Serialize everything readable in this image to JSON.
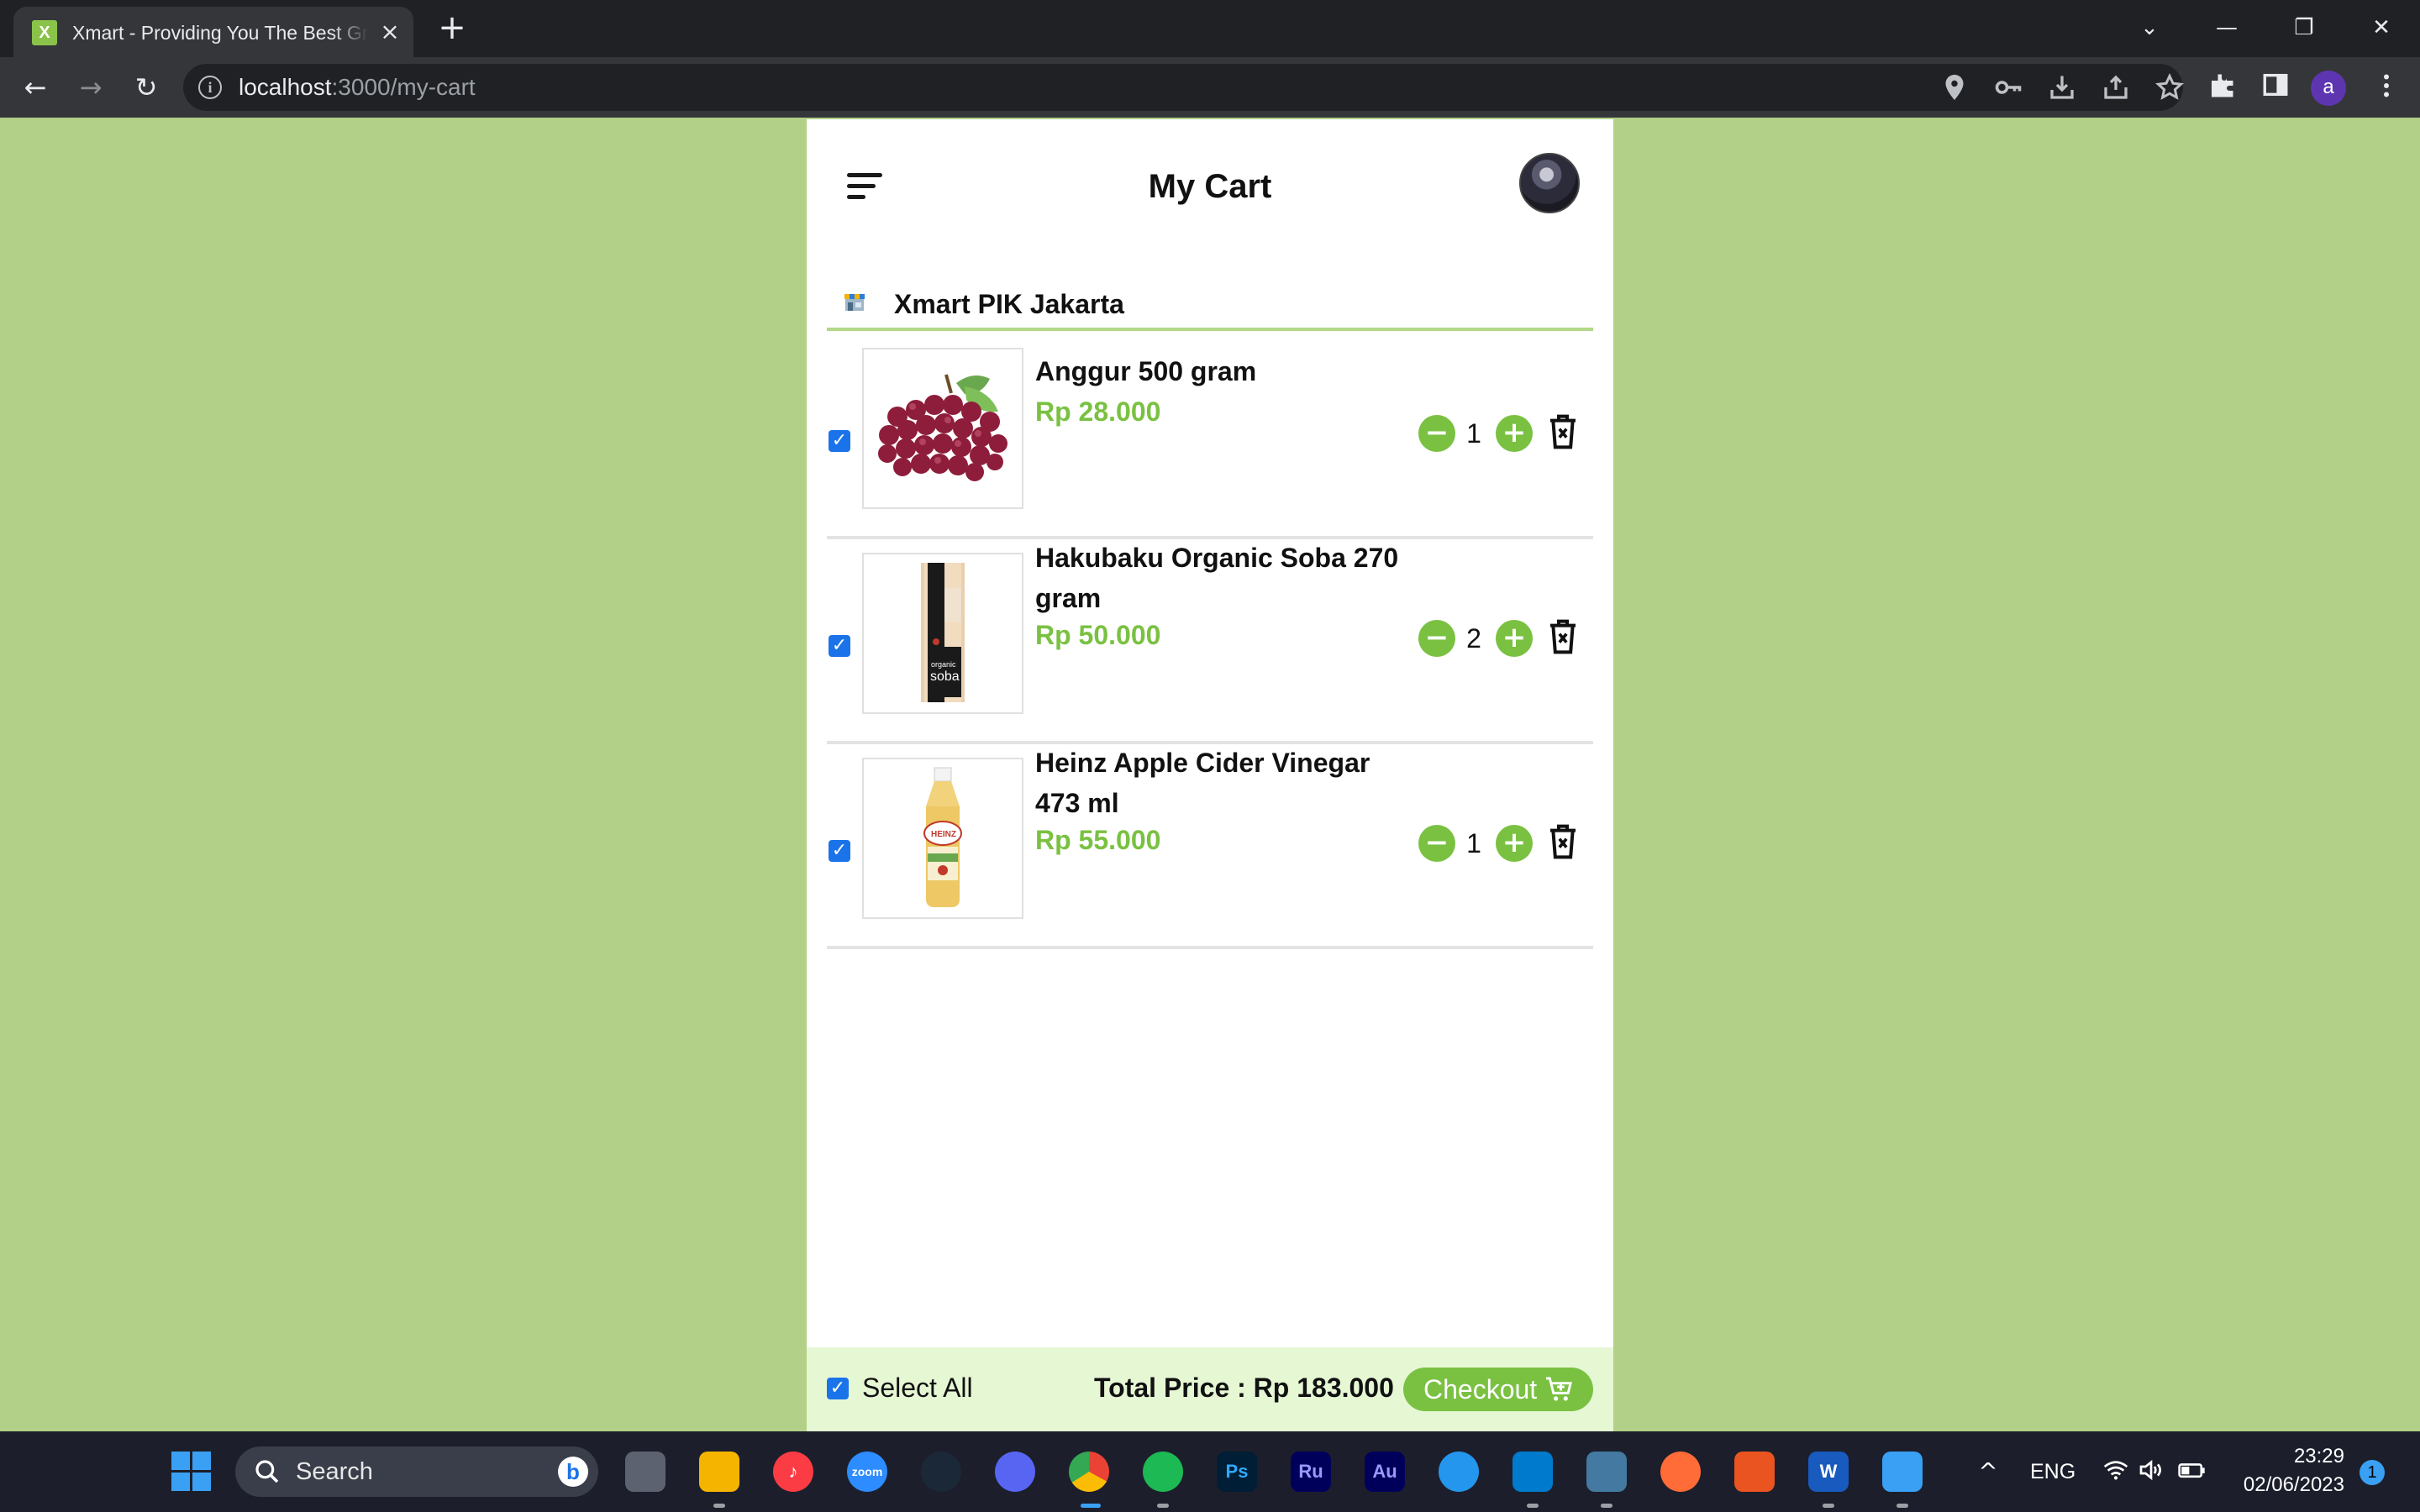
{
  "browser": {
    "tab_title": "Xmart - Providing You The Best Groceries",
    "tab_favicon_letter": "X",
    "tab_close": "×",
    "new_tab": "+",
    "url_host": "localhost",
    "url_path": ":3000/my-cart",
    "window_controls": {
      "dropdown": "⌄",
      "minimize": "—",
      "restore": "❐",
      "close": "✕"
    },
    "nav": {
      "back": "←",
      "forward": "→",
      "reload": "↻"
    },
    "info_icon": "i",
    "omnibox_icons": [
      "location-icon",
      "key-icon",
      "install-icon",
      "share-icon",
      "star-icon"
    ],
    "toolbar_icons": [
      "extensions-icon",
      "side-panel-icon",
      "more-icon"
    ],
    "profile_letter": "a"
  },
  "app": {
    "title": "My Cart",
    "store": {
      "name": "Xmart PIK Jakarta"
    },
    "accent_color": "#7ac142",
    "background_color": "#b2d088",
    "items": [
      {
        "name": "Anggur 500 gram",
        "price": "Rp 28.000",
        "quantity": "1",
        "checked": true,
        "image": "grapes"
      },
      {
        "name": "Hakubaku Organic Soba 270 gram",
        "price": "Rp 50.000",
        "quantity": "2",
        "checked": true,
        "image": "soba"
      },
      {
        "name": "Heinz Apple Cider Vinegar 473 ml",
        "price": "Rp 55.000",
        "quantity": "1",
        "checked": true,
        "image": "vinegar"
      }
    ],
    "minus_symbol": "−",
    "plus_symbol": "+",
    "footer": {
      "select_all_label": "Select All",
      "select_all_checked": true,
      "total_label": "Total Price : Rp 183.000",
      "checkout_label": "Checkout"
    }
  },
  "taskbar": {
    "search_placeholder": "Search",
    "bing_letter": "b",
    "apps": [
      "Task View",
      "File Explorer",
      "iTunes",
      "Zoom",
      "Steam",
      "Discord",
      "Chrome",
      "Spotify",
      "Photoshop",
      "Rush",
      "Audition",
      "Docker",
      "VS Code",
      "MySQL Workbench",
      "Postman",
      "Ubuntu",
      "Word",
      "Photos"
    ],
    "app_labels": {
      "zoom": "zoom",
      "ps": "Ps",
      "ru": "Ru",
      "au": "Au",
      "word": "W"
    },
    "tray_chevron": "^",
    "language": "ENG",
    "time": "23:29",
    "date": "02/06/2023",
    "notifications": "1"
  }
}
